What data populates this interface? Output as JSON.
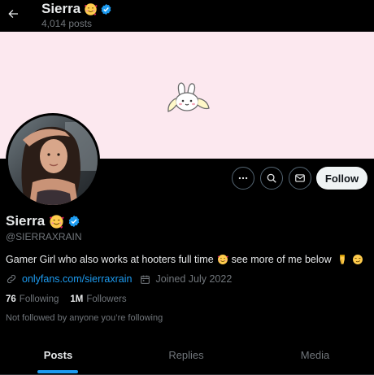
{
  "header": {
    "name": "Sierra",
    "posts_count": "4,014 posts",
    "back_icon": "arrow-left-icon",
    "emoji_icon": "smiling-face-with-hearts-icon",
    "verified_icon": "verified-badge-icon"
  },
  "banner": {
    "background": "#fce8ef",
    "art_icon": "bunny-mascot-icon"
  },
  "actions": {
    "more_icon": "more-icon",
    "search_icon": "search-icon",
    "message_icon": "message-icon",
    "follow_label": "Follow"
  },
  "profile": {
    "name": "Sierra",
    "handle": "@SIERRAXRAIN",
    "bio_part1": "Gamer Girl who also works at hooters full time",
    "bio_part2": "see more of me below",
    "bio_emojis": [
      "smiling-face-with-hearts-icon",
      "backhand-index-pointing-down-icon",
      "smirking-face-icon"
    ],
    "link": "onlyfans.com/sierraxrain",
    "joined": "Joined July 2022",
    "following_count": "76",
    "following_label": "Following",
    "followers_count": "1M",
    "followers_label": "Followers",
    "not_followed": "Not followed by anyone you’re following"
  },
  "tabs": [
    {
      "label": "Posts",
      "active": true
    },
    {
      "label": "Replies",
      "active": false
    },
    {
      "label": "Media",
      "active": false
    }
  ],
  "colors": {
    "accent": "#1d9bf0",
    "text": "#e7e9ea",
    "muted": "#71767b",
    "background": "#000000"
  }
}
